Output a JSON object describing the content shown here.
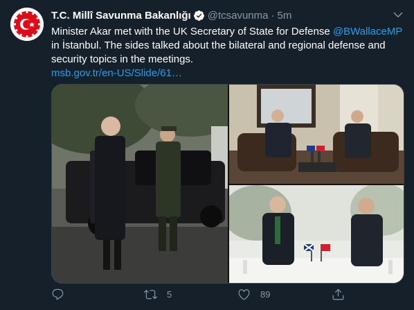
{
  "tweet": {
    "author_name": "T.C. Millî Savunma Bakanlığı",
    "handle": "@tcsavunma",
    "separator": "·",
    "time": "5m",
    "text_line1_a": "Minister Akar met with the UK Secretary of State for Defense ",
    "mention": "@BWallaceMP",
    "text_line2": "in İstanbul. The sides talked about the bilateral and regional defense and",
    "text_line3": "security topics in the meetings.",
    "link": "msb.gov.tr/en-US/Slide/61…"
  },
  "actions": {
    "reply_icon": "reply-icon",
    "retweet_icon": "retweet-icon",
    "retweet_count": "5",
    "like_icon": "heart-icon",
    "like_count": "89",
    "share_icon": "share-icon"
  },
  "colors": {
    "background": "#15202b",
    "text": "#ffffff",
    "muted": "#8899a6",
    "accent": "#1da1f2"
  }
}
